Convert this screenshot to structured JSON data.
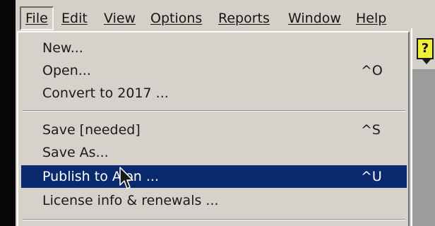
{
  "menubar": {
    "items": [
      {
        "label": "File"
      },
      {
        "label": "Edit"
      },
      {
        "label": "View"
      },
      {
        "label": "Options"
      },
      {
        "label": "Reports"
      },
      {
        "label": "Window"
      },
      {
        "label": "Help"
      }
    ],
    "active_item": "File"
  },
  "file_menu": {
    "items": [
      {
        "label": "New...",
        "shortcut": ""
      },
      {
        "label": "Open...",
        "shortcut": "^O"
      },
      {
        "label": "Convert to 2017 ...",
        "shortcut": ""
      },
      {
        "label": "Save [needed]",
        "shortcut": "^S"
      },
      {
        "label": "Save As...",
        "shortcut": ""
      },
      {
        "label": "Publish to Aion ...",
        "shortcut": "^U"
      },
      {
        "label": "License info & renewals ...",
        "shortcut": ""
      }
    ],
    "highlighted_item": "Publish to Aion ..."
  },
  "toolbar": {
    "help_icon_glyph": "?"
  },
  "colors": {
    "menu_background": "#d6d2cb",
    "highlight_background": "#0b2a6e",
    "highlight_text": "#ffffff",
    "help_icon_yellow": "#f2ef3a"
  }
}
